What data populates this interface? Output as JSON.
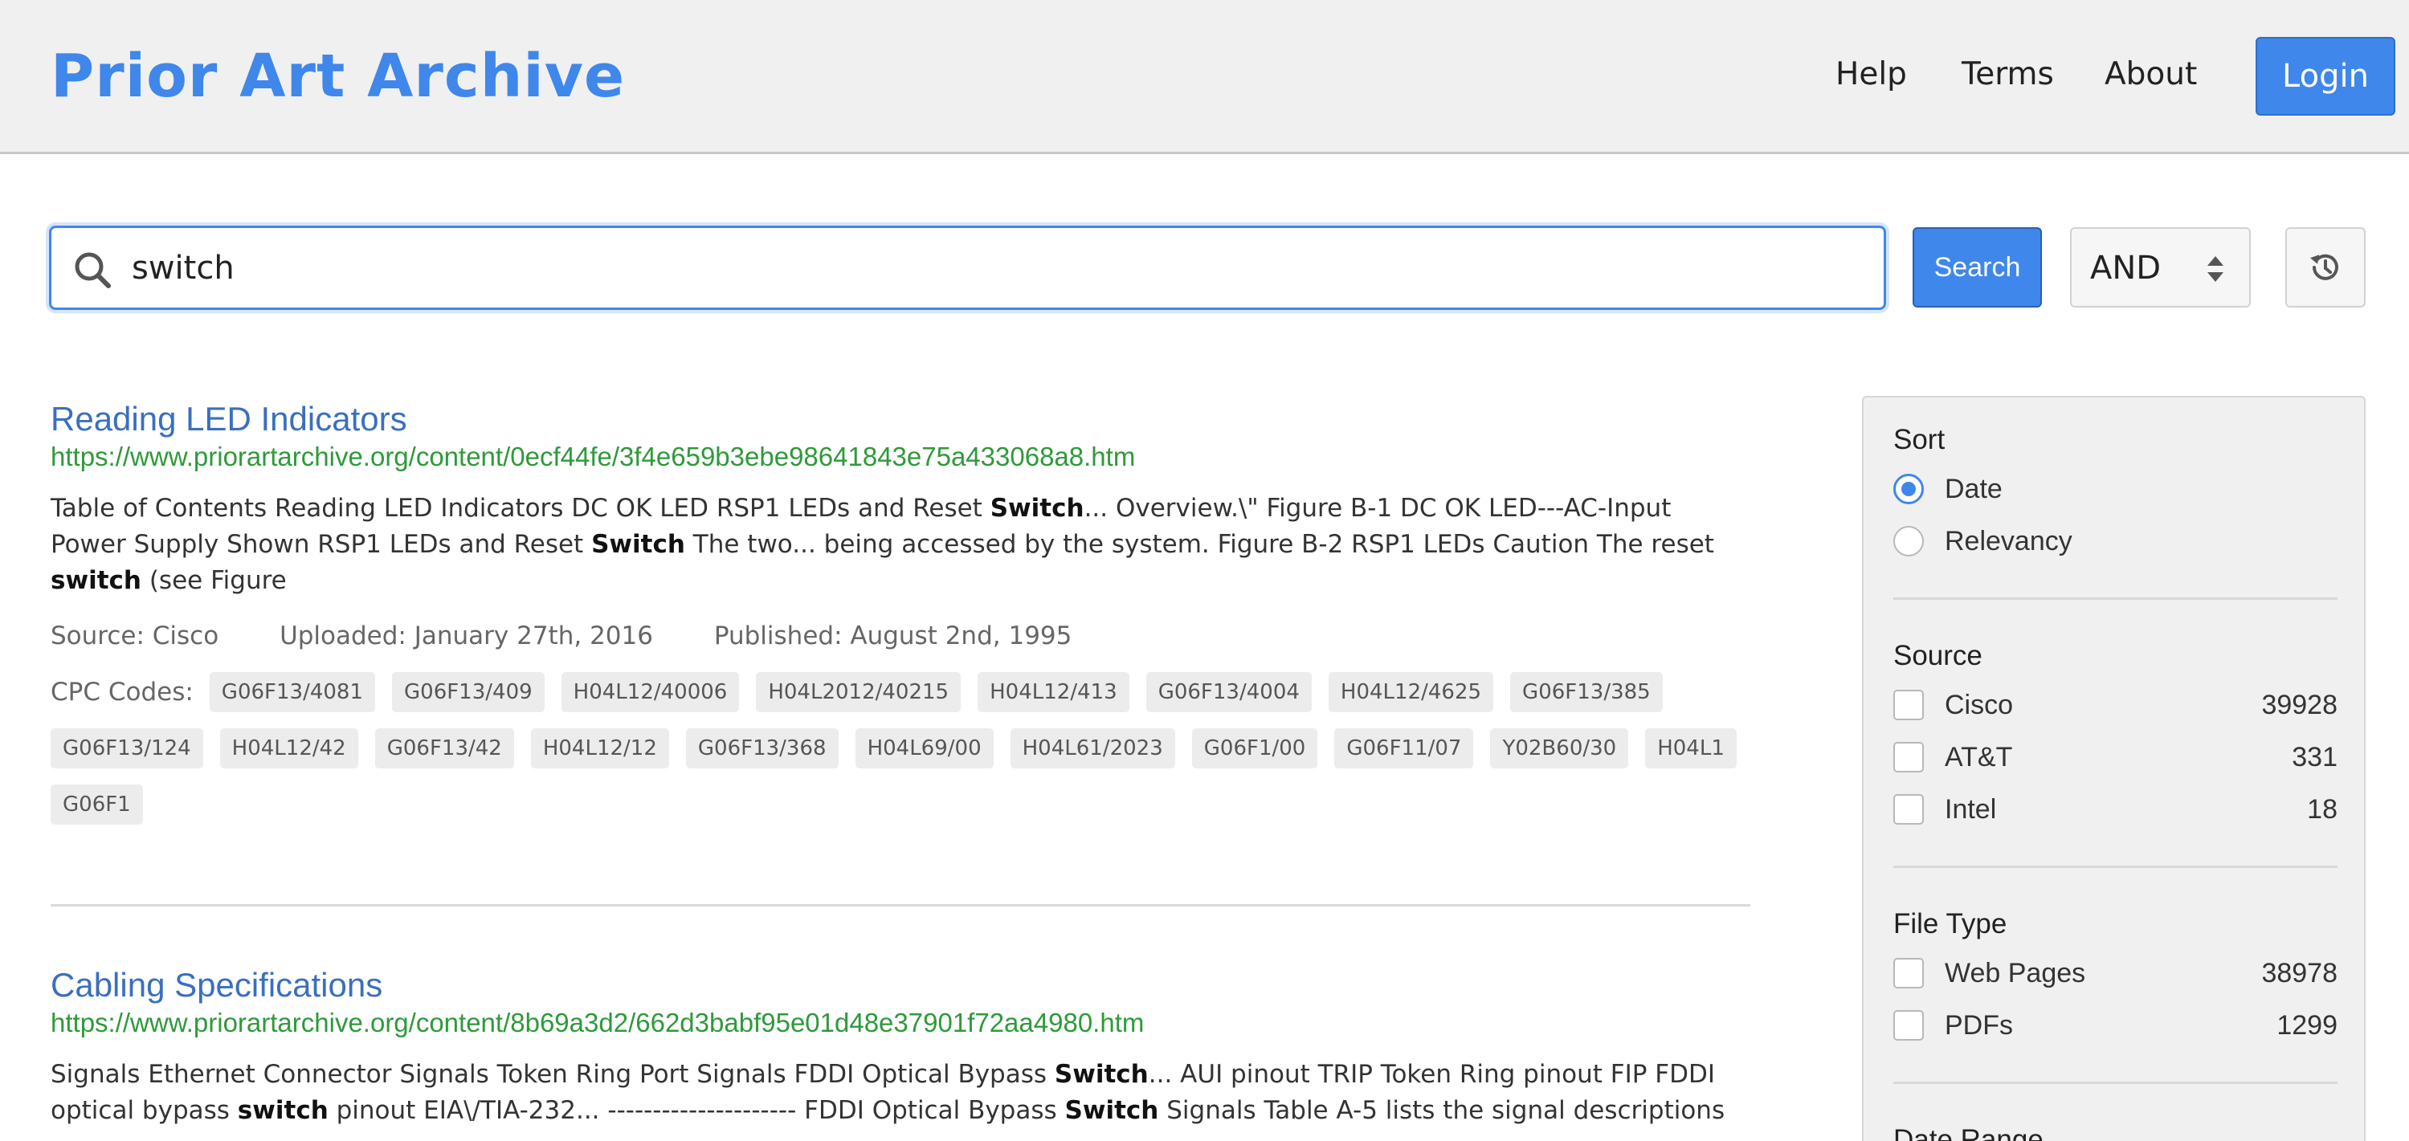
{
  "header": {
    "brand": "Prior Art Archive",
    "nav": {
      "help": "Help",
      "terms": "Terms",
      "about": "About"
    },
    "login_label": "Login"
  },
  "search": {
    "query": "switch",
    "button_label": "Search",
    "operator": "AND"
  },
  "results": [
    {
      "title": "Reading LED Indicators",
      "url": "https://www.priorartarchive.org/content/0ecf44fe/3f4e659b3ebe98641843e75a433068a8.htm",
      "snippet": [
        "Table of Contents Reading LED Indicators DC OK LED RSP1 LEDs and Reset ",
        "Switch",
        "... Overview.\\\" Figure B-1 DC OK LED---AC-Input Power Supply Shown RSP1 LEDs and Reset ",
        "Switch",
        " The two... being accessed by the system. Figure B-2 RSP1 LEDs Caution The reset ",
        "switch",
        " (see Figure"
      ],
      "source": "Source: Cisco",
      "uploaded": "Uploaded: January 27th, 2016",
      "published": "Published: August 2nd, 1995",
      "cpc_label": "CPC Codes:",
      "cpc_codes": [
        "G06F13/4081",
        "G06F13/409",
        "H04L12/40006",
        "H04L2012/40215",
        "H04L12/413",
        "G06F13/4004",
        "H04L12/4625",
        "G06F13/385",
        "G06F13/124",
        "H04L12/42",
        "G06F13/42",
        "H04L12/12",
        "G06F13/368",
        "H04L69/00",
        "H04L61/2023",
        "G06F1/00",
        "G06F11/07",
        "Y02B60/30",
        "H04L1",
        "G06F1"
      ]
    },
    {
      "title": "Cabling Specifications",
      "url": "https://www.priorartarchive.org/content/8b69a3d2/662d3babf95e01d48e37901f72aa4980.htm",
      "snippet": [
        "Signals Ethernet Connector Signals Token Ring Port Signals FDDI Optical Bypass ",
        "Switch",
        "... AUI pinout TRIP Token Ring pinout FIP FDDI optical bypass ",
        "switch",
        " pinout EIA\\/TIA-232... --------------------- FDDI Optical Bypass ",
        "Switch",
        " Signals Table A-5 lists the signal descriptions"
      ]
    }
  ],
  "sidebar": {
    "sort": {
      "heading": "Sort",
      "options": [
        {
          "label": "Date",
          "selected": true
        },
        {
          "label": "Relevancy",
          "selected": false
        }
      ]
    },
    "source": {
      "heading": "Source",
      "items": [
        {
          "label": "Cisco",
          "count": "39928"
        },
        {
          "label": "AT&T",
          "count": "331"
        },
        {
          "label": "Intel",
          "count": "18"
        }
      ]
    },
    "file_type": {
      "heading": "File Type",
      "items": [
        {
          "label": "Web Pages",
          "count": "38978"
        },
        {
          "label": "PDFs",
          "count": "1299"
        }
      ]
    },
    "date_range": {
      "heading": "Date Range"
    }
  },
  "colors": {
    "accent": "#3f87ea",
    "title_link": "#3a6fbf",
    "url_green": "#2e9a3a"
  }
}
